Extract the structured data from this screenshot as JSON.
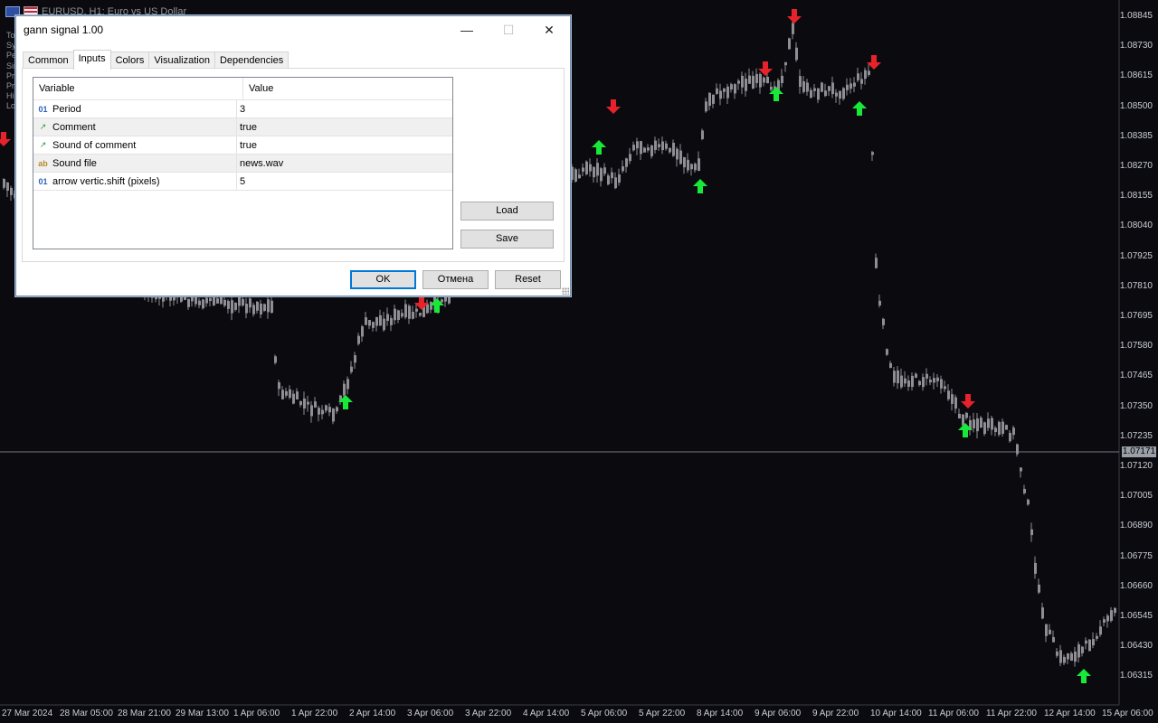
{
  "chart": {
    "symbol_title": "EURUSD, H1:  Euro vs US Dollar",
    "left_indicator_labels": [
      "To",
      "Sy",
      "Pe",
      "Sir",
      "Pr",
      "Pr",
      "Hi",
      "Lo"
    ],
    "price_ticks": [
      "1.08845",
      "1.08730",
      "1.08615",
      "1.08500",
      "1.08385",
      "1.08270",
      "1.08155",
      "1.08040",
      "1.07925",
      "1.07810",
      "1.07695",
      "1.07580",
      "1.07465",
      "1.07350",
      "1.07235",
      "1.07120",
      "1.07005",
      "1.06890",
      "1.06775",
      "1.06660",
      "1.06545",
      "1.06430",
      "1.06315"
    ],
    "current_price": "1.07171",
    "time_ticks": [
      "27 Mar 2024",
      "28 Mar 05:00",
      "28 Mar 21:00",
      "29 Mar 13:00",
      "1 Apr 06:00",
      "1 Apr 22:00",
      "2 Apr 14:00",
      "3 Apr 06:00",
      "3 Apr 22:00",
      "4 Apr 14:00",
      "5 Apr 06:00",
      "5 Apr 22:00",
      "8 Apr 14:00",
      "9 Apr 06:00",
      "9 Apr 22:00",
      "10 Apr 14:00",
      "11 Apr 06:00",
      "11 Apr 22:00",
      "12 Apr 14:00",
      "15 Apr 06:00"
    ],
    "colors": {
      "background": "#0b0b0f",
      "candle": "#8e8e94",
      "up_arrow": "#18e838",
      "down_arrow": "#e8222a",
      "grid_line": "#9aa0a8"
    }
  },
  "dialog": {
    "title": "gann signal 1.00",
    "window_buttons": {
      "minimize": "—",
      "maximize": "☐",
      "close": "✕"
    },
    "tabs": [
      {
        "label": "Common",
        "active": false
      },
      {
        "label": "Inputs",
        "active": true
      },
      {
        "label": "Colors",
        "active": false
      },
      {
        "label": "Visualization",
        "active": false
      },
      {
        "label": "Dependencies",
        "active": false
      }
    ],
    "grid": {
      "headers": {
        "variable": "Variable",
        "value": "Value"
      },
      "rows": [
        {
          "type_icon": "01",
          "type": "int",
          "variable": "Period",
          "value": "3"
        },
        {
          "type_icon": "↗",
          "type": "bool",
          "variable": "Comment",
          "value": "true"
        },
        {
          "type_icon": "↗",
          "type": "bool",
          "variable": "Sound of comment",
          "value": "true"
        },
        {
          "type_icon": "ab",
          "type": "str",
          "variable": "Sound file",
          "value": "news.wav"
        },
        {
          "type_icon": "01",
          "type": "int",
          "variable": "arrow vertic.shift (pixels)",
          "value": "5"
        }
      ]
    },
    "load_label": "Load",
    "save_label": "Save",
    "ok_label": "OK",
    "cancel_label": "Отмена",
    "reset_label": "Reset"
  }
}
